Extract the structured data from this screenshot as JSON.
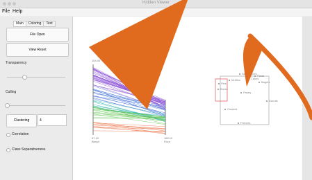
{
  "window": {
    "title": "Hidden Viewer"
  },
  "menu": {
    "file": "File",
    "help": "Help"
  },
  "sidebar": {
    "tabs": [
      "Main",
      "Coloring",
      "Text"
    ],
    "file_open": "File Open",
    "view_reset": "View Reset",
    "transparency_label": "Transparency",
    "transparency_level": 0.3,
    "culling_label": "Culling",
    "culling_level": 0.0,
    "clustering_button": "Clustering",
    "clustering_value": "4",
    "correlation_label": "Correlation",
    "class_sep_label": "Class Separativeness"
  },
  "parallel_coords": {
    "axis_left_top": "104.00",
    "axis_left_bottom_value": "67.10",
    "axis_left_bottom_name": "Bread",
    "axis_right_bottom_value": "185.10",
    "axis_right_bottom_name": "Flour",
    "colors": [
      "#8a4fd6",
      "#3f6fd8",
      "#38b7b0",
      "#5cc14a",
      "#e86a3c"
    ]
  },
  "scatter": {
    "labels": [
      "Sandwiches",
      "Cakes",
      "Pasta",
      "Bread",
      "Cookies",
      "Pretzels",
      "Bagels",
      "Donuts",
      "Muffins",
      "Pastry",
      "Pies"
    ]
  }
}
